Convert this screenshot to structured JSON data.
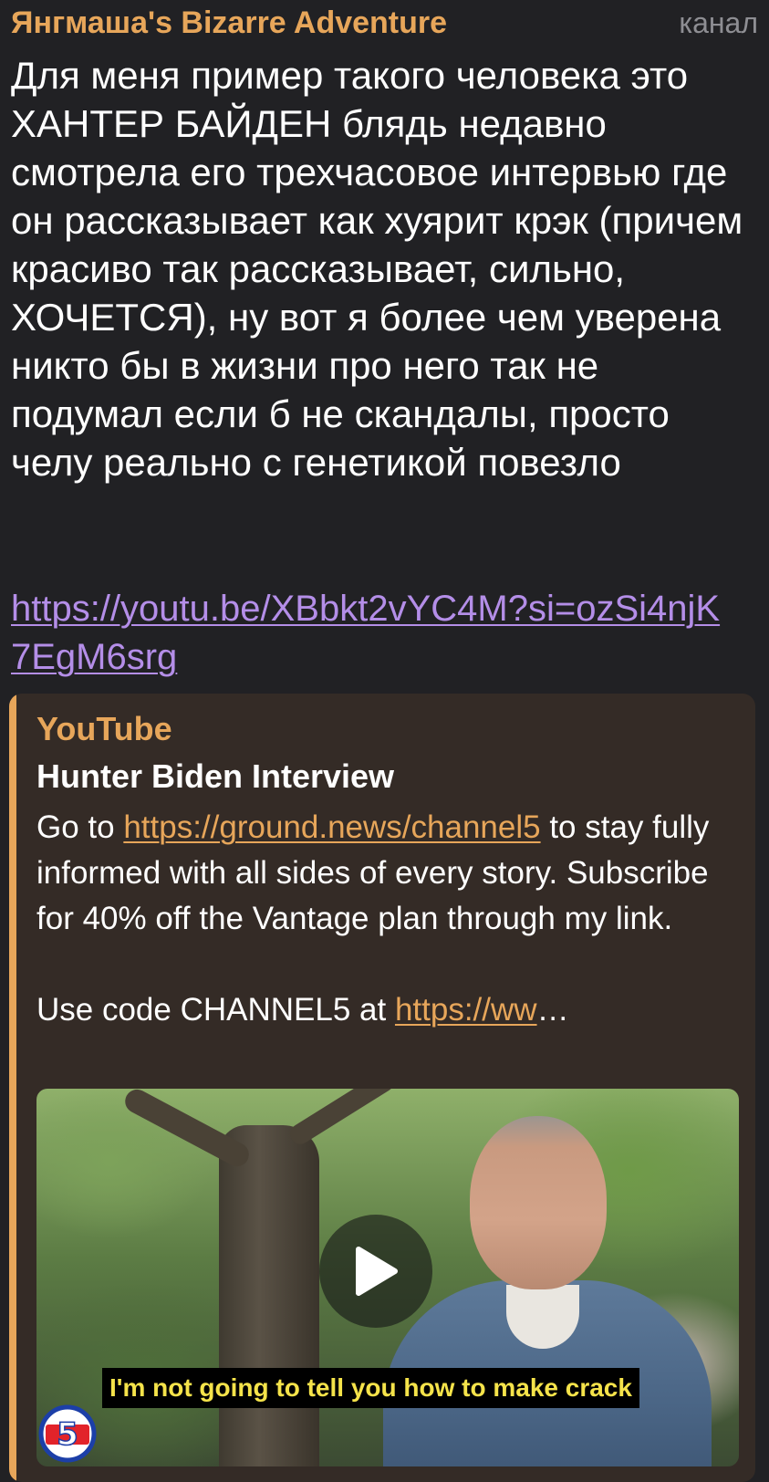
{
  "header": {
    "channel_name": "Янгмаша's Bizarre Adventure",
    "channel_tag": "канал"
  },
  "message": {
    "text": "Для меня пример такого человека это ХАНТЕР БАЙДЕН блядь недавно смотрела его трехчасовое интервью где он рассказывает как хуярит крэк (причем красиво так рассказывает, сильно, ХОЧЕТСЯ), ну вот я более чем уверена никто бы в жизни про него так не подумал если б не скандалы, просто челу реально с генетикой повезло",
    "link": "https://youtu.be/XBbkt2vYC4M?si=ozSi4njK7EgM6srg"
  },
  "preview": {
    "site_name": "YouTube",
    "title": "Hunter Biden Interview",
    "desc_part1": "Go to ",
    "desc_link1": "https://ground.news/channel5",
    "desc_part2": " to stay fully informed with all sides of every story. Subscribe for 40% off the Vantage plan through my link.",
    "desc_part3": "Use code CHANNEL5 at ",
    "desc_link2": "https://ww",
    "desc_ellipsis": "…",
    "thumbnail": {
      "subtitle": "I'm not going to tell you how to make crack",
      "logo_text": "5",
      "play_icon": "play-icon"
    }
  },
  "colors": {
    "background": "#212124",
    "accent": "#e7a65a",
    "link": "#b48ee8",
    "preview_bg": "#342b26",
    "muted": "#8e8e93"
  }
}
